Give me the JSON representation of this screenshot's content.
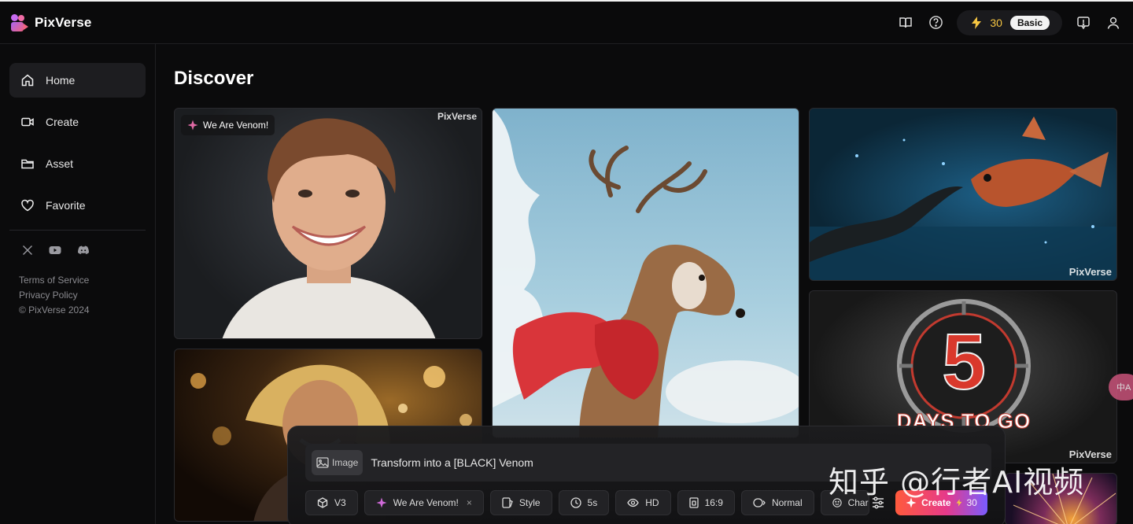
{
  "app": {
    "name": "PixVerse"
  },
  "header": {
    "credits": "30",
    "plan": "Basic"
  },
  "sidebar": {
    "items": [
      {
        "label": "Home",
        "icon": "home-icon",
        "active": true
      },
      {
        "label": "Create",
        "icon": "video-camera-icon"
      },
      {
        "label": "Asset",
        "icon": "folder-icon"
      },
      {
        "label": "Favorite",
        "icon": "heart-icon"
      }
    ],
    "socials": [
      "x-icon",
      "youtube-icon",
      "discord-icon"
    ],
    "legal": {
      "terms": "Terms of Service",
      "privacy": "Privacy Policy",
      "copyright": "© PixVerse 2024"
    }
  },
  "main": {
    "title": "Discover",
    "cards": [
      {
        "tag": "We Are Venom!",
        "watermark": "PixVerse",
        "subject": "smiling young man portrait"
      },
      {
        "watermark": "",
        "subject": "reindeer wearing red cape in sky"
      },
      {
        "watermark": "PixVerse",
        "subject": "eel facing fish underwater"
      },
      {
        "watermark": "PixVerse",
        "overlay_text": "5",
        "overlay_caption": "DAYS TO GO",
        "subject": "metallic 5 countdown"
      },
      {
        "watermark": "",
        "subject": "woman with blonde hair, concert lights"
      },
      {
        "watermark": "",
        "subject": "fireworks"
      }
    ]
  },
  "prompt": {
    "mode_label": "Image",
    "text": "Transform into a [BLACK] Venom",
    "options": [
      {
        "label": "V3",
        "icon": "cube-icon"
      },
      {
        "label": "We Are Venom!",
        "icon": "sparkle-icon",
        "removable": true
      },
      {
        "label": "Style",
        "icon": "style-icon"
      },
      {
        "label": "5s",
        "icon": "clock-icon"
      },
      {
        "label": "HD",
        "icon": "eye-icon"
      },
      {
        "label": "16:9",
        "icon": "aspect-icon"
      },
      {
        "label": "Normal",
        "icon": "motion-icon"
      },
      {
        "label": "Char",
        "icon": "face-icon"
      }
    ],
    "create_label": "Create",
    "create_cost": "30"
  },
  "overlay": {
    "watermark_text": "知乎 @行者AI视频",
    "translate_label": "中A"
  },
  "colors": {
    "accent_gold": "#f5c542",
    "create_gradient_start": "#ff5a3c",
    "create_gradient_end": "#7a5cff"
  }
}
